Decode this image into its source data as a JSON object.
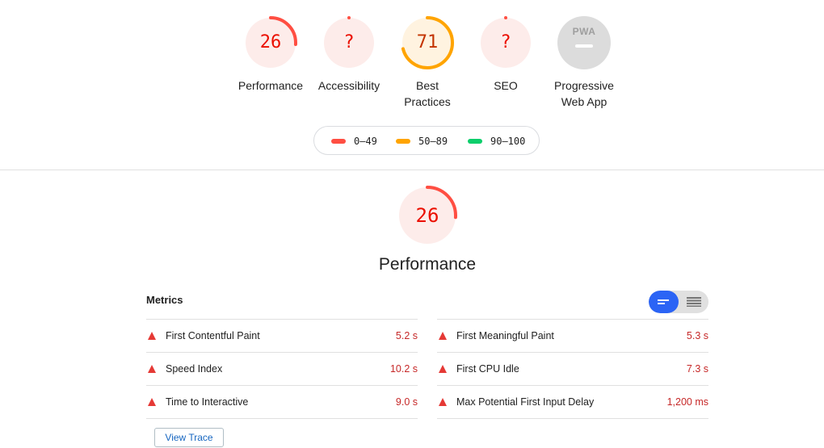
{
  "colors": {
    "fail": "#ff4e42",
    "fail_bg": "#fdecea",
    "average": "#ffa400",
    "average_bg": "#fff3e0",
    "pass": "#0cce6b",
    "na": "#9e9e9e",
    "na_bg": "#dcdcdc",
    "accent": "#2b64f5"
  },
  "categories": [
    {
      "label": "Performance",
      "value": "26",
      "score": 0.26,
      "status": "fail"
    },
    {
      "label": "Accessibility",
      "value": "?",
      "score": 0.0,
      "status": "fail"
    },
    {
      "label": "Best Practices",
      "label_line1": "Best",
      "label_line2": "Practices",
      "value": "71",
      "score": 0.71,
      "status": "average"
    },
    {
      "label": "SEO",
      "value": "?",
      "score": 0.0,
      "status": "fail"
    },
    {
      "label": "Progressive Web App",
      "label_line1": "Progressive",
      "label_line2": "Web App",
      "badge_text": "PWA",
      "status": "na",
      "icon": "pwa-badge-icon"
    }
  ],
  "legend": [
    {
      "range": "0–49",
      "color": "#ff4e42"
    },
    {
      "range": "50–89",
      "color": "#ffa400"
    },
    {
      "range": "90–100",
      "color": "#0cce6b"
    }
  ],
  "performance": {
    "value": "26",
    "score": 0.26,
    "title": "Performance",
    "metrics_header": "Metrics",
    "metrics_left": [
      {
        "name": "First Contentful Paint",
        "value": "5.2 s"
      },
      {
        "name": "Speed Index",
        "value": "10.2 s"
      },
      {
        "name": "Time to Interactive",
        "value": "9.0 s"
      }
    ],
    "metrics_right": [
      {
        "name": "First Meaningful Paint",
        "value": "5.3 s"
      },
      {
        "name": "First CPU Idle",
        "value": "7.3 s"
      },
      {
        "name": "Max Potential First Input Delay",
        "value": "1,200 ms"
      }
    ],
    "view_trace_label": "View Trace",
    "toggle": {
      "selected": "opportunities-view",
      "icons": [
        "compact-list-icon",
        "detailed-list-icon"
      ]
    }
  }
}
